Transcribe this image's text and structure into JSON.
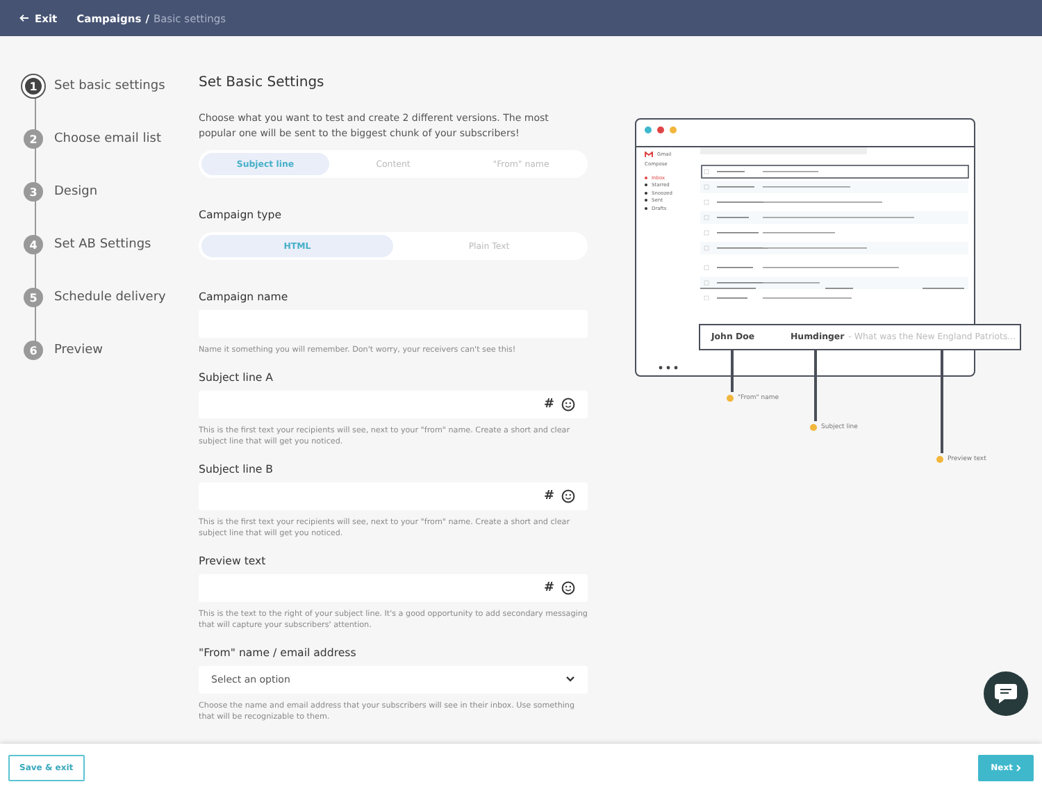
{
  "header": {
    "exit": "Exit",
    "breadcrumb": "Campaigns",
    "separator": "/",
    "current": "Basic settings"
  },
  "steps": [
    {
      "number": "1",
      "label": "Set basic settings",
      "selected": true
    },
    {
      "number": "2",
      "label": "Choose email list",
      "selected": false
    },
    {
      "number": "3",
      "label": "Design",
      "selected": false
    },
    {
      "number": "4",
      "label": "Set AB Settings",
      "selected": false
    },
    {
      "number": "5",
      "label": "Schedule delivery",
      "selected": false
    },
    {
      "number": "6",
      "label": "Preview",
      "selected": false
    }
  ],
  "form": {
    "title": "Set Basic Settings",
    "description": "Choose what you want to test and create 2 different versions. The most popular one will be sent to the biggest chunk of your subscribers!",
    "test_options": [
      {
        "label": "Subject line",
        "selected": true
      },
      {
        "label": "Content",
        "selected": false
      },
      {
        "label": "\"From\" name",
        "selected": false
      }
    ],
    "type_label": "Campaign type",
    "type_options": [
      {
        "label": "HTML",
        "selected": true
      },
      {
        "label": "Plain Text",
        "selected": false
      }
    ],
    "fields": [
      {
        "kind": "text",
        "label": "Campaign name",
        "hint": "Name it something you will remember. Don't worry, your receivers can't see this!"
      },
      {
        "kind": "emoji",
        "label": "Subject line A",
        "symbol": "#",
        "hint": "This is the first text your recipients will see, next to your \"from\" name. Create a short and clear subject line that will get you noticed."
      },
      {
        "kind": "emoji",
        "label": "Subject line B",
        "symbol": "#",
        "hint": "This is the first text your recipients will see, next to your \"from\" name. Create a short and clear subject line that will get you noticed."
      },
      {
        "kind": "emoji",
        "label": "Preview text",
        "symbol": "#",
        "hint": "This is the text to the right of your subject line. It's a good opportunity to add secondary messaging that will capture your subscribers' attention."
      },
      {
        "kind": "select",
        "label": "\"From\" name / email address",
        "value": "Select an option",
        "hint": "Choose the name and email address that your subscribers will see in their inbox. Use something that will be recognizable to them."
      }
    ]
  },
  "preview": {
    "app_name": "Gmail",
    "compose": "Compose",
    "folders": [
      {
        "label": "Inbox",
        "selected": true
      },
      {
        "label": "Starred",
        "selected": false
      },
      {
        "label": "Snoozed",
        "selected": false
      },
      {
        "label": "Sent",
        "selected": false
      },
      {
        "label": "Drafts",
        "selected": false
      }
    ],
    "from_name": "John Doe",
    "subject": "Humdinger",
    "preview_text": "- What was the New England Patriots...",
    "callouts": [
      "\"From\" name",
      "Subject line",
      "Preview text"
    ]
  },
  "footer": {
    "save": "Save & exit",
    "next": "Next"
  }
}
